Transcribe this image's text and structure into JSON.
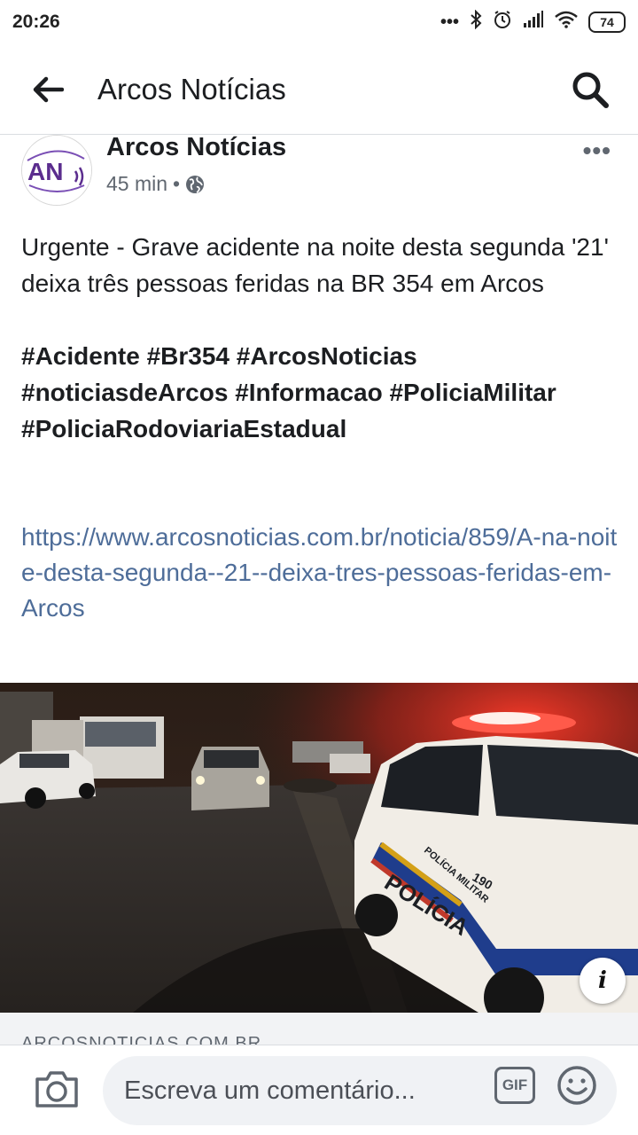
{
  "status_bar": {
    "time": "20:26",
    "signal_dots": "•••",
    "battery": "74",
    "icons": [
      "dots-icon",
      "bluetooth-icon",
      "alarm-icon",
      "signal-icon",
      "wifi-icon",
      "battery-icon"
    ]
  },
  "header": {
    "title": "Arcos Notícias"
  },
  "post": {
    "page_name": "Arcos Notícias",
    "avatar_text": "AN",
    "time": "45 min",
    "separator": "•",
    "more": "•••",
    "text": "Urgente - Grave acidente na noite desta segunda '21' deixa três pessoas feridas na BR 354 em Arcos",
    "hashtags": "#Acidente #Br354 #ArcosNoticias #noticiasdeArcos #Informacao #PoliciaMilitar #PoliciaRodoviariaEstadual",
    "link": "https://www.arcosnoticias.com.br/noticia/859/A-na-noite-desta-segunda--21--deixa-tres-pessoas-feridas-em-Arcos",
    "photo": {
      "vehicle_text": "POLÍCIA",
      "vehicle_badge": "POLÍCIA MILITAR",
      "vehicle_number": "190"
    },
    "info_label": "i",
    "link_domain": "ARCOSNOTICIAS.COM.BR"
  },
  "comment_bar": {
    "placeholder": "Escreva um comentário...",
    "gif_label": "GIF"
  },
  "colors": {
    "link": "#4e6d99",
    "avatar_purple": "#5b2d8e",
    "text": "#1c1e21",
    "secondary": "#606770"
  }
}
